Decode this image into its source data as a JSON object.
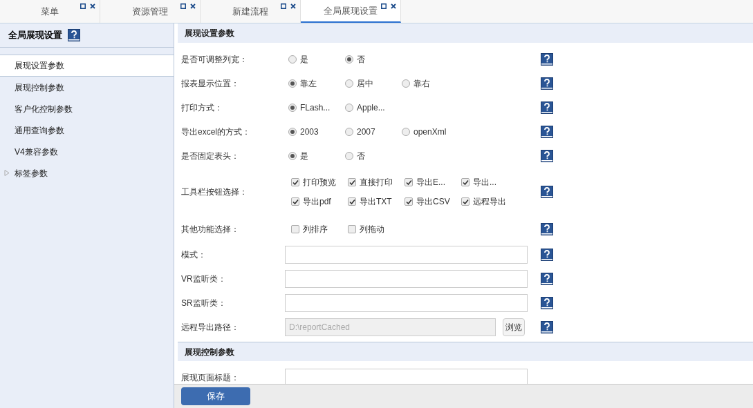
{
  "tabs": [
    {
      "label": "菜单",
      "selected": false
    },
    {
      "label": "资源管理",
      "selected": false
    },
    {
      "label": "新建流程",
      "selected": false
    },
    {
      "label": "全局展现设置",
      "selected": true
    }
  ],
  "sidebar": {
    "title": "全局展现设置",
    "items": [
      {
        "label": "展现设置参数",
        "selected": true
      },
      {
        "label": "展现控制参数",
        "selected": false
      },
      {
        "label": "客户化控制参数",
        "selected": false
      },
      {
        "label": "通用查询参数",
        "selected": false
      },
      {
        "label": "V4兼容参数",
        "selected": false
      },
      {
        "label": "标签参数",
        "selected": false,
        "expanded": false
      }
    ]
  },
  "sections": [
    {
      "title": "展现设置参数",
      "rows": [
        {
          "kind": "radio",
          "label": "是否可调整列宽：",
          "options": [
            {
              "label": "是",
              "selected": false
            },
            {
              "label": "否",
              "selected": true
            }
          ]
        },
        {
          "kind": "radio",
          "label": "报表显示位置：",
          "options": [
            {
              "label": "靠左",
              "selected": true
            },
            {
              "label": "居中",
              "selected": false
            },
            {
              "label": "靠右",
              "selected": false
            }
          ]
        },
        {
          "kind": "radio",
          "label": "打印方式：",
          "options": [
            {
              "label": "FLash...",
              "selected": true
            },
            {
              "label": "Apple...",
              "selected": false
            }
          ]
        },
        {
          "kind": "radio",
          "label": "导出excel的方式：",
          "options": [
            {
              "label": "2003",
              "selected": true
            },
            {
              "label": "2007",
              "selected": false
            },
            {
              "label": "openXml",
              "selected": false
            }
          ]
        },
        {
          "kind": "radio",
          "label": "是否固定表头：",
          "options": [
            {
              "label": "是",
              "selected": true
            },
            {
              "label": "否",
              "selected": false
            }
          ]
        },
        {
          "kind": "checkbox",
          "label": "工具栏按钮选择：",
          "options": [
            {
              "label": "打印预览",
              "checked": true
            },
            {
              "label": "直接打印",
              "checked": true
            },
            {
              "label": "导出E...",
              "checked": true
            },
            {
              "label": "导出...",
              "checked": true
            },
            {
              "label": "导出pdf",
              "checked": true
            },
            {
              "label": "导出TXT",
              "checked": true
            },
            {
              "label": "导出CSV",
              "checked": true
            },
            {
              "label": "远程导出",
              "checked": true
            }
          ]
        },
        {
          "kind": "checkbox",
          "label": "其他功能选择：",
          "options": [
            {
              "label": "列排序",
              "checked": false
            },
            {
              "label": "列拖动",
              "checked": false
            }
          ]
        },
        {
          "kind": "text",
          "label": "模式："
        },
        {
          "kind": "text",
          "label": "VR监听类："
        },
        {
          "kind": "text",
          "label": "SR监听类："
        },
        {
          "kind": "path",
          "label": "远程导出路径：",
          "value": "D:\\reportCached",
          "button": "浏览"
        }
      ]
    },
    {
      "title": "展现控制参数",
      "rows": [
        {
          "kind": "text",
          "label": "展现页面标题："
        }
      ]
    }
  ],
  "save_button": "保存"
}
